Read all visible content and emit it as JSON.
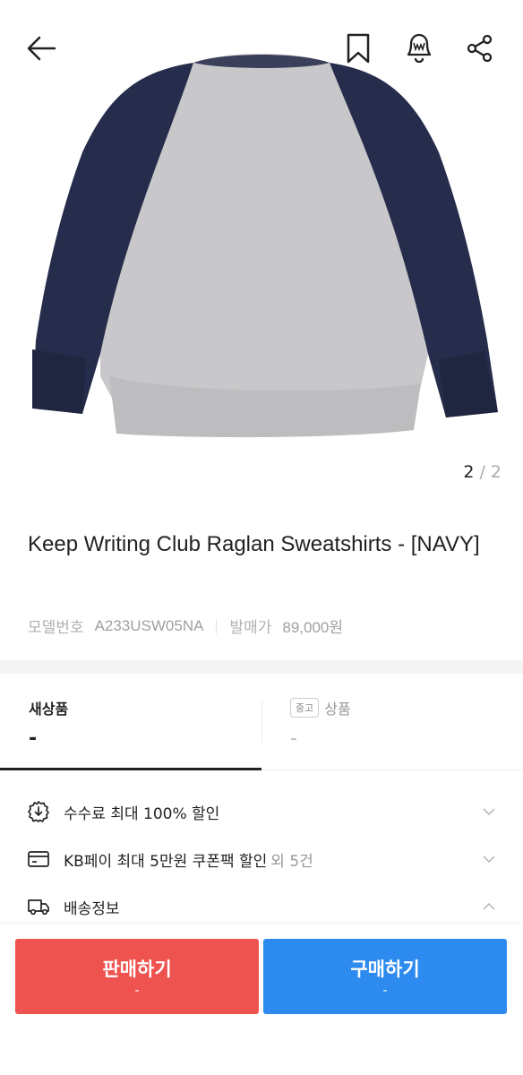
{
  "product": {
    "name": "Keep Writing Club Raglan Sweatshirts - [NAVY]",
    "image_counter": {
      "current": "2",
      "separator": "/",
      "total": "2"
    },
    "model_label": "모델번호",
    "model_number": "A233USW05NA",
    "release_price_label": "발매가",
    "release_price": "89,000원"
  },
  "tabs": {
    "new": {
      "label": "새상품",
      "price": "-"
    },
    "used": {
      "badge": "중고",
      "label": "상품",
      "price": "-"
    }
  },
  "info_rows": [
    {
      "icon": "discount-icon",
      "text": "수수료 최대 100% 할인",
      "sub": ""
    },
    {
      "icon": "card-icon",
      "text": "KB페이 최대 5만원 쿠폰팩 할인",
      "sub": "외 5건"
    },
    {
      "icon": "truck-icon",
      "text": "배송정보",
      "sub": ""
    }
  ],
  "actions": {
    "sell": {
      "label": "판매하기",
      "price": "-"
    },
    "buy": {
      "label": "구매하기",
      "price": "-"
    }
  },
  "colors": {
    "sell": "#ef5350",
    "buy": "#2d8bef",
    "sweatshirt_body": "#c9c9cb",
    "sweatshirt_sleeve": "#252b4a"
  }
}
